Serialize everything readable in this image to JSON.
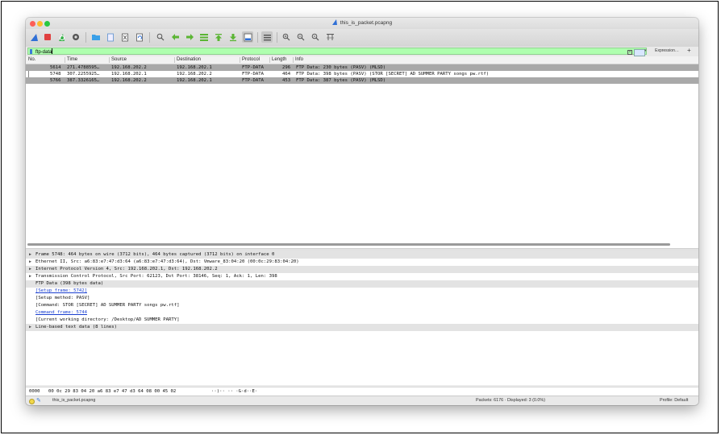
{
  "window": {
    "title": "this_is_packet.pcapng"
  },
  "toolbar": {
    "icons": [
      "shark-fin-start-icon",
      "stop-icon",
      "restart-icon",
      "options-icon",
      "open-folder-icon",
      "file-icon",
      "close-file-icon",
      "reload-icon",
      "find-icon",
      "back-arrow-icon",
      "forward-arrow-icon",
      "go-to-packet-icon",
      "first-packet-icon",
      "last-packet-icon",
      "autoscroll-icon",
      "colorize-icon",
      "zoom-in-icon",
      "zoom-out-icon",
      "zoom-normal-icon",
      "resize-columns-icon"
    ]
  },
  "filter": {
    "value": "ftp-data",
    "expression_label": "Expression…",
    "plus_label": "+"
  },
  "columns": [
    "No.",
    "Time",
    "Source",
    "Destination",
    "Protocol",
    "Length",
    "Info"
  ],
  "packets": [
    {
      "no": "5614",
      "time": "271.4788595…",
      "source": "192.168.202.2",
      "destination": "192.168.202.1",
      "protocol": "FTP-DATA",
      "length": "296",
      "info": "FTP Data: 230 bytes (PASV) (MLSD)"
    },
    {
      "no": "5748",
      "time": "307.2255925…",
      "source": "192.168.202.1",
      "destination": "192.168.202.2",
      "protocol": "FTP-DATA",
      "length": "464",
      "info": "FTP Data: 398 bytes (PASV) (STOR [SECRET] AD SUMMER PARTY songs pw.rtf)"
    },
    {
      "no": "5766",
      "time": "387.3326165…",
      "source": "192.168.202.2",
      "destination": "192.168.202.1",
      "protocol": "FTP-DATA",
      "length": "453",
      "info": "FTP Data: 387 bytes (PASV) (MLSD)"
    }
  ],
  "details": [
    {
      "text": "Frame 5748: 464 bytes on wire (3712 bits), 464 bytes captured (3712 bits) on interface 0",
      "arrow": "▶"
    },
    {
      "text": "Ethernet II, Src: a6:83:e7:47:d3:64 (a6:83:e7:47:d3:64), Dst: Vmware_83:04:20 (00:0c:29:83:04:20)",
      "arrow": "▶"
    },
    {
      "text": "Internet Protocol Version 4, Src: 192.168.202.1, Dst: 192.168.202.2",
      "arrow": "▶"
    },
    {
      "text": "Transmission Control Protocol, Src Port: 62123, Dst Port: 38146, Seq: 1, Ack: 1, Len: 398",
      "arrow": "▶"
    },
    {
      "text": "FTP Data (398 bytes data)",
      "arrow": ""
    },
    {
      "text": "[Setup frame: 5742]",
      "arrow": ""
    },
    {
      "text": "[Setup method: PASV]",
      "arrow": ""
    },
    {
      "text": "[Command: STOR [SECRET] AD SUMMER PARTY songs pw.rtf]",
      "arrow": ""
    },
    {
      "text": "Command frame: 5744",
      "arrow": ""
    },
    {
      "text": "[Current working directory: /Desktop/AD SUMMER PARTY]",
      "arrow": ""
    },
    {
      "text": "Line-based text data (8 lines)",
      "arrow": "▶"
    }
  ],
  "hex": {
    "offset": "0000",
    "bytes": "00 0c 29 83 04 20 a6 83  e7 47 d3 64 08 00 45 02",
    "ascii": "··)·· ··  ·G·d··E·"
  },
  "status": {
    "file": "this_is_packet.pcapng",
    "counts": "Packets: 6176 · Displayed: 3 (0.0%)",
    "profile": "Profile: Default"
  }
}
